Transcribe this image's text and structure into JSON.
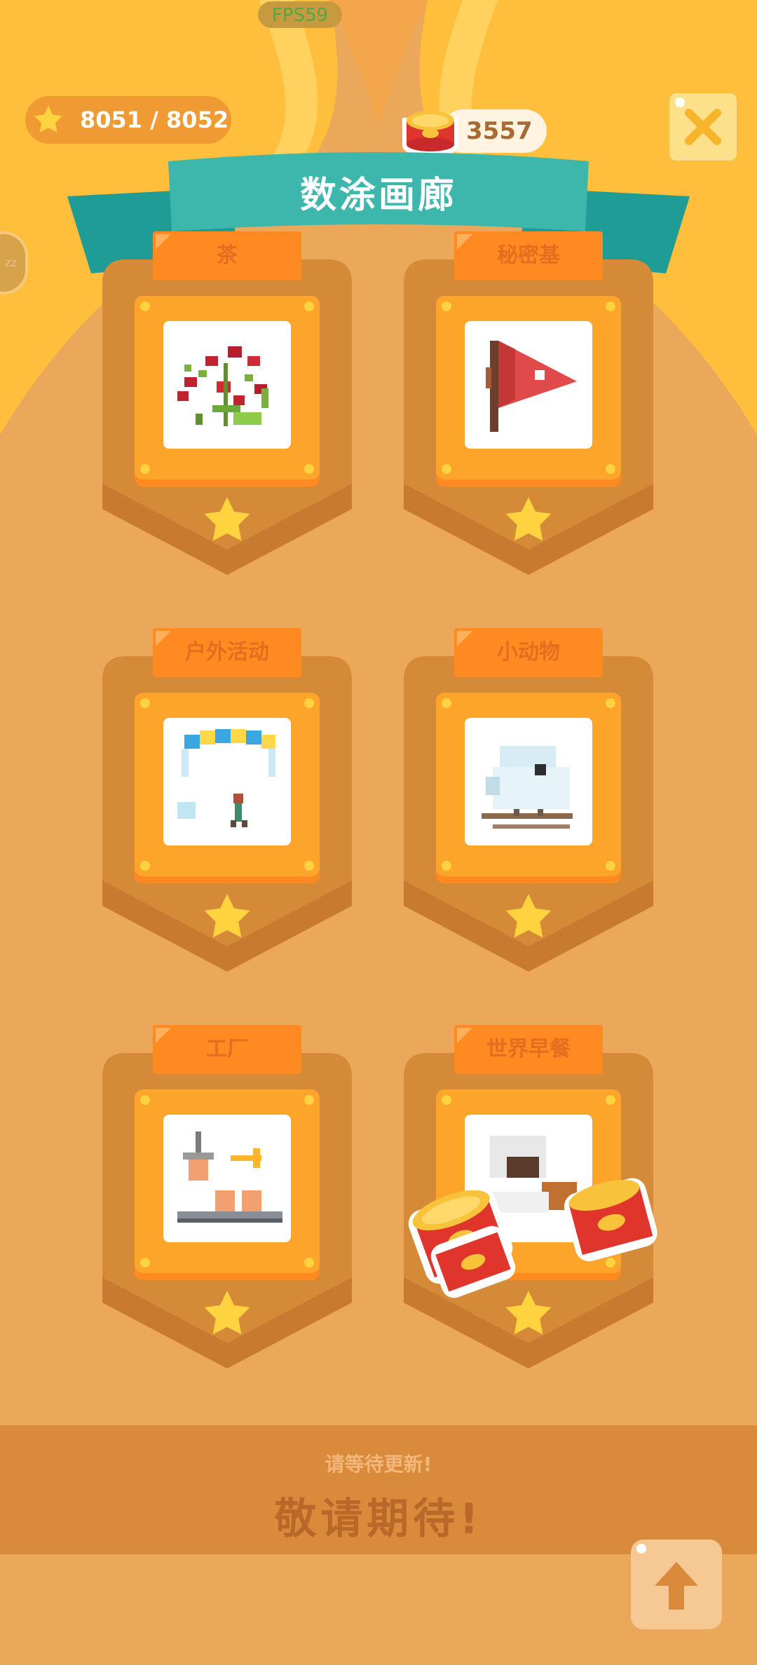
{
  "hud": {
    "fps_label": "FPS59",
    "stars_progress": "8051 / 8052",
    "coins": "3557"
  },
  "header": {
    "title": "数涂画廊"
  },
  "categories": [
    {
      "label": "茶",
      "icon": "tea-plant-pixel-art-icon"
    },
    {
      "label": "秘密基",
      "icon": "flag-pixel-art-icon"
    },
    {
      "label": "户外活动",
      "icon": "paraglider-pixel-art-icon"
    },
    {
      "label": "小动物",
      "icon": "bird-pixel-art-icon"
    },
    {
      "label": "工厂",
      "icon": "factory-conveyor-pixel-art-icon"
    },
    {
      "label": "世界早餐",
      "icon": "breakfast-pixel-art-icon"
    }
  ],
  "footer": {
    "wait_text": "请等待更新!",
    "coming_soon": "敬请期待!"
  },
  "colors": {
    "background": "#eba85a",
    "ribbon": "#3db7ac",
    "tab": "#ff8a21",
    "star": "#ffd23f"
  }
}
